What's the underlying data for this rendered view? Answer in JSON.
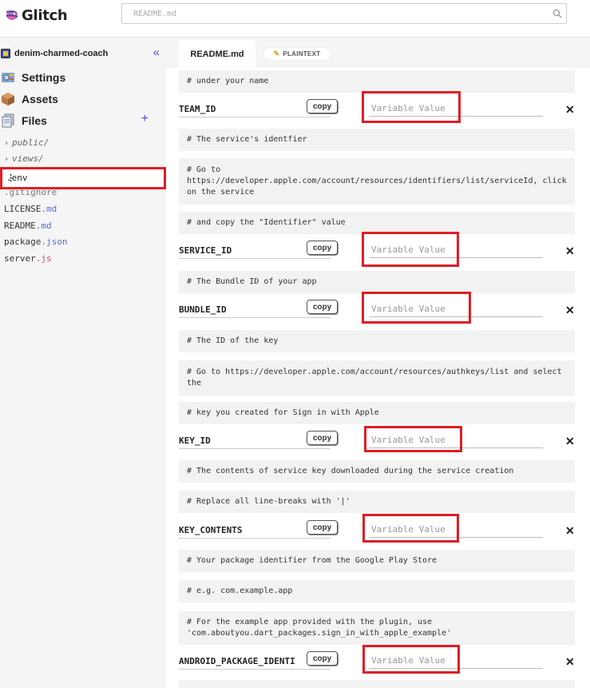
{
  "app": {
    "name": "Glitch"
  },
  "search": {
    "placeholder": "README.md"
  },
  "sidebar": {
    "project_name": "denim-charmed-coach",
    "nav": [
      {
        "label": "Settings",
        "icon": "gear-icon"
      },
      {
        "label": "Assets",
        "icon": "box-icon"
      },
      {
        "label": "Files",
        "icon": "files-icon"
      }
    ],
    "folders": [
      "public/",
      "views/"
    ],
    "files": [
      {
        "base": ".env",
        "ext": ""
      },
      {
        "base": ".gitignore",
        "ext": ""
      },
      {
        "base": "LICENSE",
        "ext": ".md"
      },
      {
        "base": "README",
        "ext": ".md"
      },
      {
        "base": "package",
        "ext": ".json"
      },
      {
        "base": "server",
        "ext": ".js"
      }
    ]
  },
  "tabs": {
    "active": "README.md",
    "plaintext": "PLAINTEXT"
  },
  "editor": {
    "copy_label": "copy",
    "value_placeholder": "Variable Value",
    "comments": [
      "# under your name",
      "# The service's identfier",
      "# Go to https://developer.apple.com/account/resources/identifiers/list/serviceId, click on the service",
      "# and copy the \"Identifier\" value",
      "# The Bundle ID of your app",
      "# The ID of the key",
      "# Go to https://developer.apple.com/account/resources/authkeys/list and select the",
      "# key you created for Sign in with Apple",
      "# The contents of service key downloaded during the service creation",
      "# Replace all line-breaks with '|'",
      "# Your package identifier from the Google Play Store",
      "# e.g. com.example.app",
      "# For the example app provided with the plugin, use 'com.aboutyou.dart_packages.sign_in_with_apple_example'"
    ],
    "variables": [
      {
        "key": "TEAM_ID",
        "value": ""
      },
      {
        "key": "SERVICE_ID",
        "value": ""
      },
      {
        "key": "BUNDLE_ID",
        "value": ""
      },
      {
        "key": "KEY_ID",
        "value": ""
      },
      {
        "key": "KEY_CONTENTS",
        "value": ""
      },
      {
        "key": "ANDROID_PACKAGE_IDENTI",
        "value": ""
      }
    ]
  },
  "colors": {
    "accent": "#5a4fcf",
    "highlight": "#e01e24",
    "comment_bg": "#f2f2f2"
  }
}
